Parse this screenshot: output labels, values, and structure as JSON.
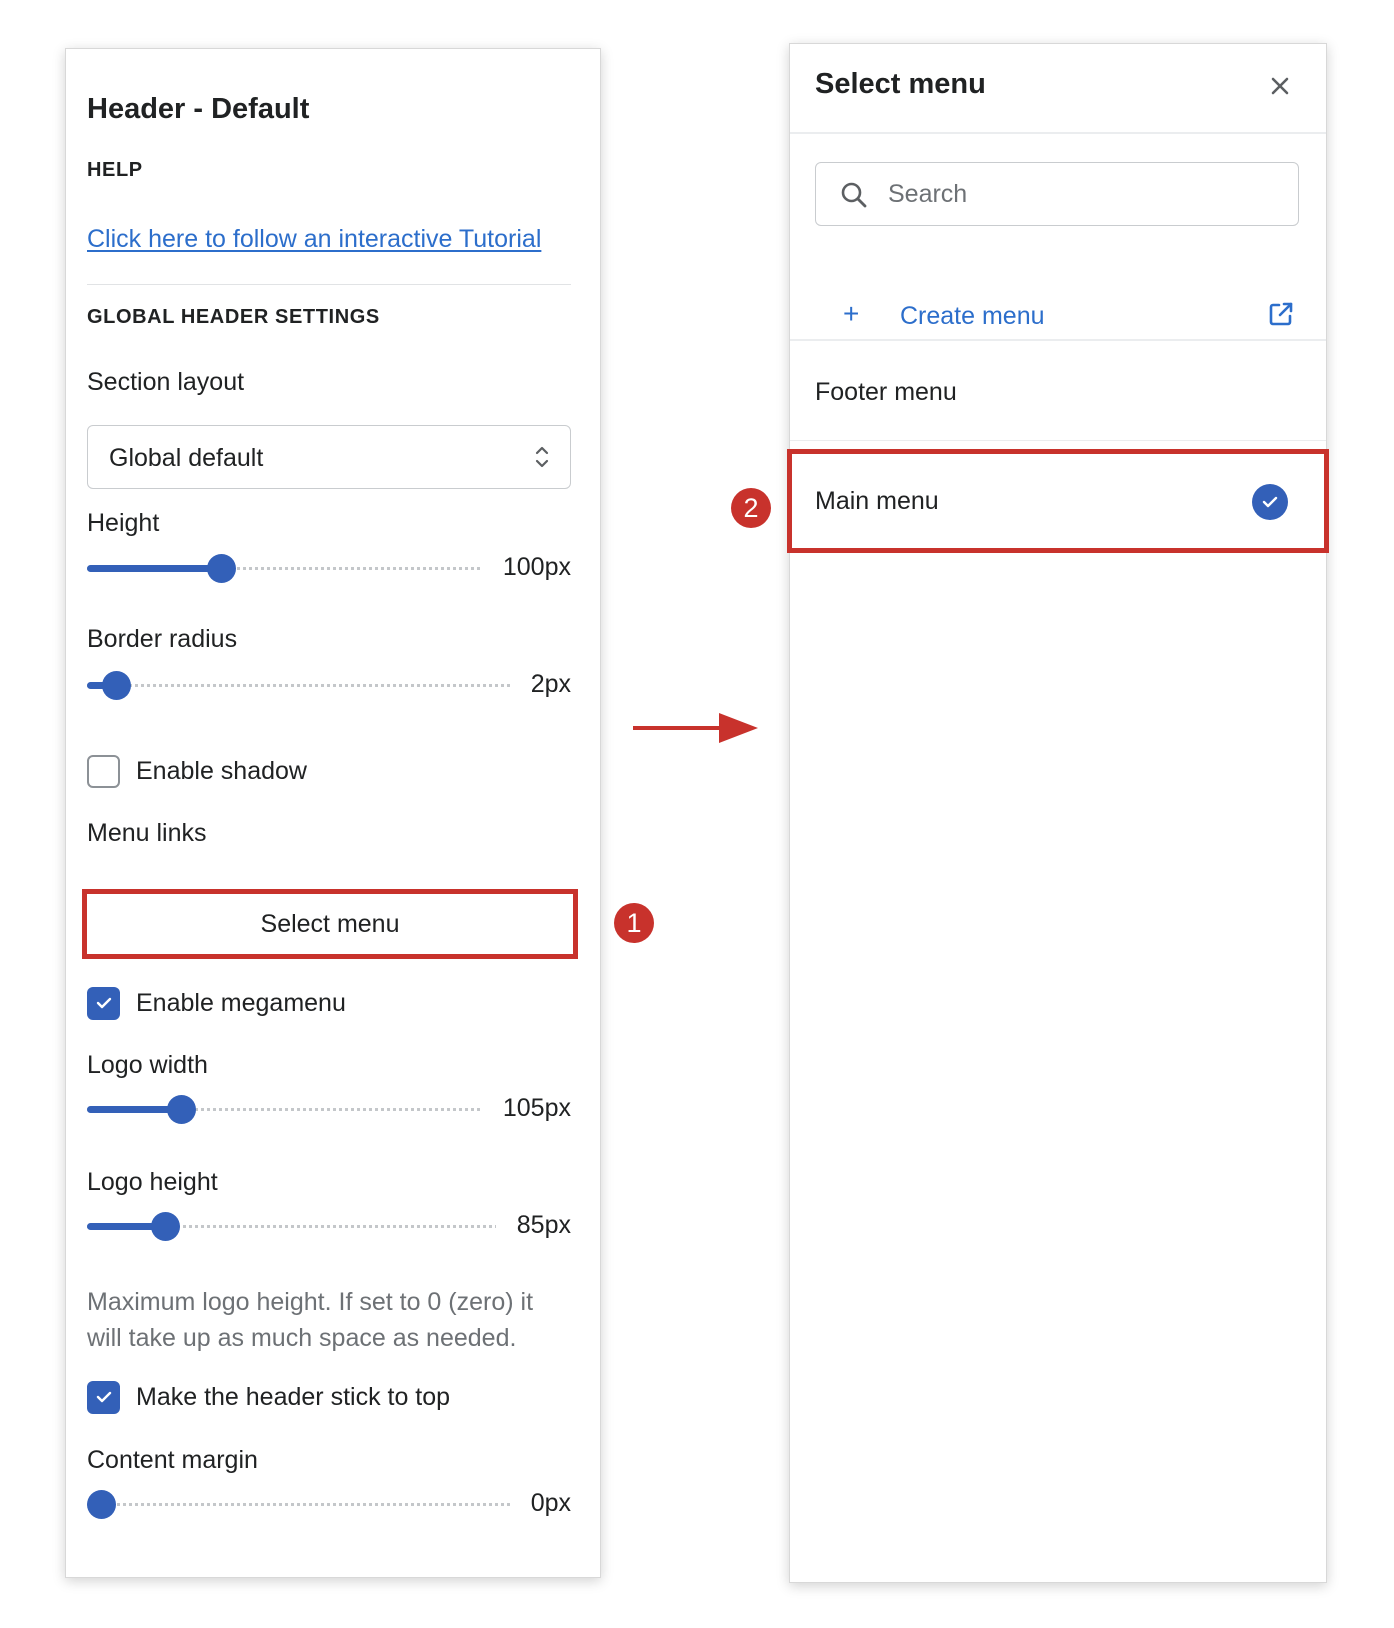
{
  "settings_panel": {
    "title": "Header - Default",
    "help_heading": "HELP",
    "tutorial_link": "Click here to follow an interactive Tutorial",
    "global_heading": "GLOBAL HEADER SETTINGS",
    "section_layout": {
      "label": "Section layout",
      "value": "Global default"
    },
    "height": {
      "label": "Height",
      "value": "100px"
    },
    "border_radius": {
      "label": "Border radius",
      "value": "2px"
    },
    "enable_shadow": {
      "label": "Enable shadow",
      "checked": false
    },
    "menu_links": {
      "label": "Menu links",
      "button_label": "Select menu"
    },
    "enable_megamenu": {
      "label": "Enable megamenu",
      "checked": true
    },
    "logo_width": {
      "label": "Logo width",
      "value": "105px"
    },
    "logo_height": {
      "label": "Logo height",
      "value": "85px",
      "help": "Maximum logo height. If set to 0 (zero) it will take up as much space as needed."
    },
    "sticky_header": {
      "label": "Make the header stick to top",
      "checked": true
    },
    "content_margin": {
      "label": "Content margin",
      "value": "0px"
    }
  },
  "steps": {
    "step1": "1",
    "step2": "2"
  },
  "select_menu_modal": {
    "title": "Select menu",
    "search_placeholder": "Search",
    "create_label": "Create menu",
    "create_symbol": "+",
    "options": [
      {
        "label": "Footer menu",
        "selected": false
      },
      {
        "label": "Main menu",
        "selected": true
      }
    ]
  },
  "colors": {
    "accent": "#3360b8",
    "link": "#2c6ecb",
    "highlight": "#c8322c"
  },
  "icons": [
    "select-arrows-icon",
    "checkmark-icon",
    "arrow-right-icon",
    "close-icon",
    "search-icon",
    "plus-icon",
    "external-link-icon"
  ]
}
